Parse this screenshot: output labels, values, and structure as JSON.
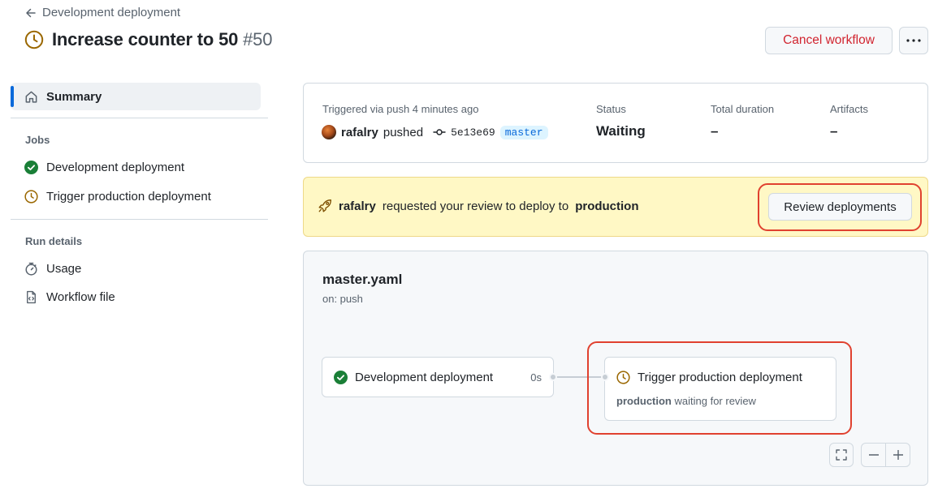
{
  "header": {
    "back_label": "Development deployment",
    "title": "Increase counter to 50",
    "run_number": "#50",
    "cancel_label": "Cancel workflow"
  },
  "sidebar": {
    "summary_label": "Summary",
    "jobs_heading": "Jobs",
    "jobs": [
      {
        "label": "Development deployment",
        "status": "success"
      },
      {
        "label": "Trigger production deployment",
        "status": "waiting"
      }
    ],
    "run_details_heading": "Run details",
    "run_details": [
      {
        "label": "Usage",
        "icon": "stopwatch-icon"
      },
      {
        "label": "Workflow file",
        "icon": "file-code-icon"
      }
    ]
  },
  "summary": {
    "trigger_text": "Triggered via push 4 minutes ago",
    "actor": "rafalry",
    "action": "pushed",
    "commit_sha": "5e13e69",
    "branch": "master",
    "status_label": "Status",
    "status_value": "Waiting",
    "duration_label": "Total duration",
    "duration_value": "–",
    "artifacts_label": "Artifacts",
    "artifacts_value": "–"
  },
  "review_banner": {
    "actor": "rafalry",
    "text": "requested your review to deploy to",
    "environment": "production",
    "button_label": "Review deployments"
  },
  "workflow": {
    "file_name": "master.yaml",
    "trigger": "on: push",
    "jobs": [
      {
        "label": "Development deployment",
        "duration": "0s",
        "status": "success"
      },
      {
        "label": "Trigger production deployment",
        "status": "waiting",
        "env": "production",
        "note": "waiting for review"
      }
    ]
  },
  "colors": {
    "accent": "#0969da",
    "success": "#1a7f37",
    "waiting": "#9a6700",
    "danger": "#d1242f",
    "banner_bg": "#fff8c5",
    "highlight_outline": "#e0412f"
  }
}
